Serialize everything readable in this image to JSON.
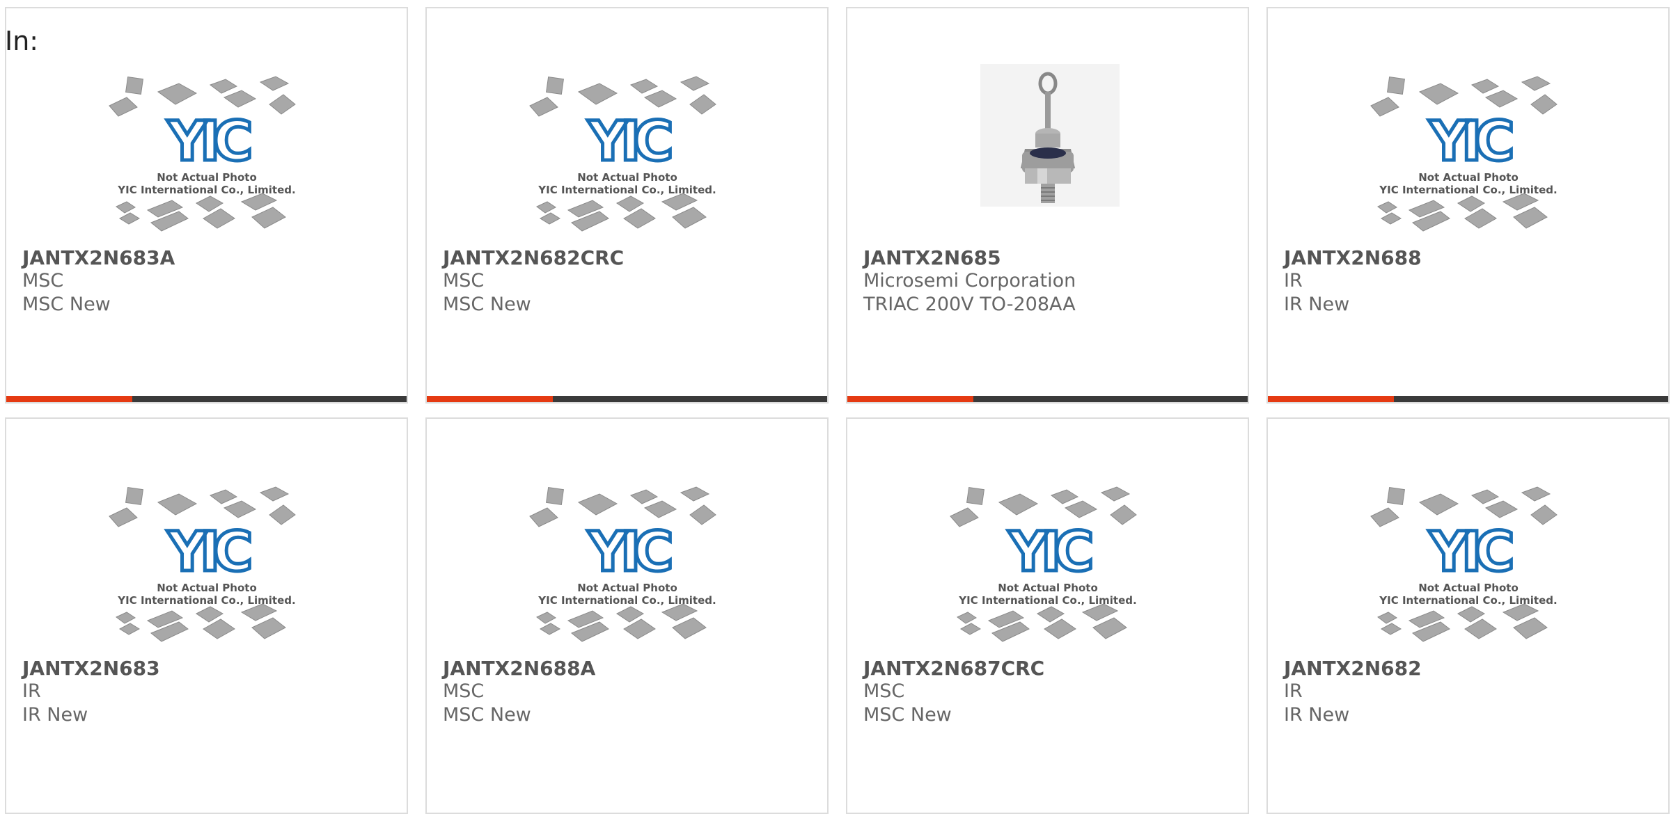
{
  "heading": "In:",
  "colors": {
    "accent": "#e53a12",
    "bar": "#3a3a3a",
    "border": "#dcdcdc"
  },
  "placeholder": {
    "line1": "Not Actual Photo",
    "line2": "YIC International Co., Limited.",
    "logo": "YIC"
  },
  "cards": [
    {
      "part": "JANTX2N683A",
      "mfr": "MSC",
      "desc": "MSC New",
      "image": "placeholder-logo"
    },
    {
      "part": "JANTX2N682CRC",
      "mfr": "MSC",
      "desc": "MSC New",
      "image": "placeholder-logo"
    },
    {
      "part": "JANTX2N685",
      "mfr": "Microsemi Corporation",
      "desc": "TRIAC 200V TO-208AA",
      "image": "stud-thyristor"
    },
    {
      "part": "JANTX2N688",
      "mfr": "IR",
      "desc": "IR New",
      "image": "placeholder-logo"
    },
    {
      "part": "JANTX2N683",
      "mfr": "IR",
      "desc": "IR New",
      "image": "placeholder-logo"
    },
    {
      "part": "JANTX2N688A",
      "mfr": "MSC",
      "desc": "MSC New",
      "image": "placeholder-logo"
    },
    {
      "part": "JANTX2N687CRC",
      "mfr": "MSC",
      "desc": "MSC New",
      "image": "placeholder-logo"
    },
    {
      "part": "JANTX2N682",
      "mfr": "IR",
      "desc": "IR New",
      "image": "placeholder-logo"
    }
  ]
}
